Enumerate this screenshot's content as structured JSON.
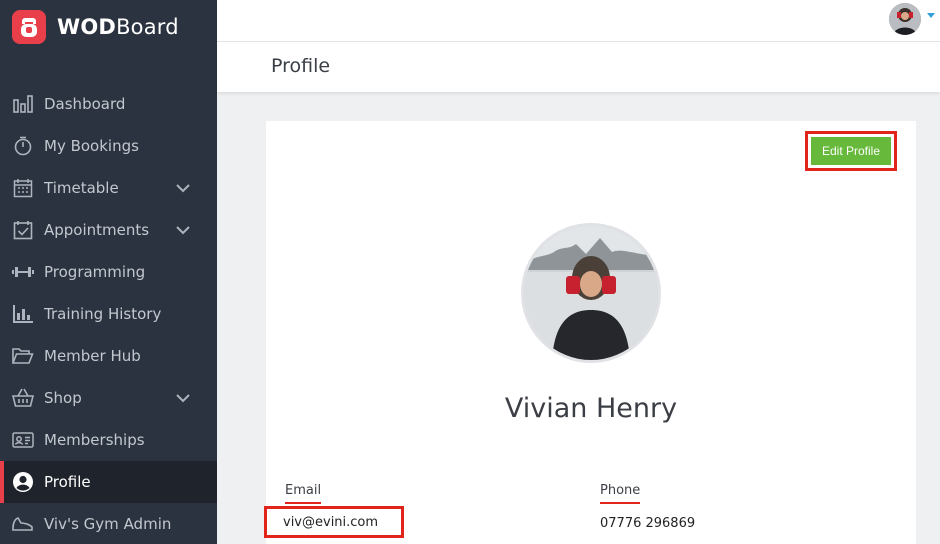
{
  "brand": {
    "name_bold": "WOD",
    "name_rest": "Board",
    "accent_color": "#e83f4b"
  },
  "sidebar": {
    "items": [
      {
        "label": "Dashboard",
        "icon": "bar-chart-icon"
      },
      {
        "label": "My Bookings",
        "icon": "stopwatch-icon"
      },
      {
        "label": "Timetable",
        "icon": "calendar-grid-icon",
        "expandable": true
      },
      {
        "label": "Appointments",
        "icon": "calendar-check-icon",
        "expandable": true
      },
      {
        "label": "Programming",
        "icon": "dumbbell-icon"
      },
      {
        "label": "Training History",
        "icon": "chart-history-icon"
      },
      {
        "label": "Member Hub",
        "icon": "folder-open-icon"
      },
      {
        "label": "Shop",
        "icon": "basket-icon",
        "expandable": true
      },
      {
        "label": "Memberships",
        "icon": "id-card-icon"
      },
      {
        "label": "Profile",
        "icon": "user-circle-icon",
        "active": true
      },
      {
        "label": "Viv's Gym Admin",
        "icon": "shoe-icon"
      }
    ]
  },
  "page": {
    "title": "Profile"
  },
  "profile": {
    "edit_button": "Edit Profile",
    "name": "Vivian Henry",
    "email_label": "Email",
    "email_value": "viv@evini.com",
    "phone_label": "Phone",
    "phone_value": "07776 296869"
  },
  "colors": {
    "edit_button": "#66b93a",
    "highlight": "#e1251b",
    "sidebar_bg": "#2c3340"
  }
}
